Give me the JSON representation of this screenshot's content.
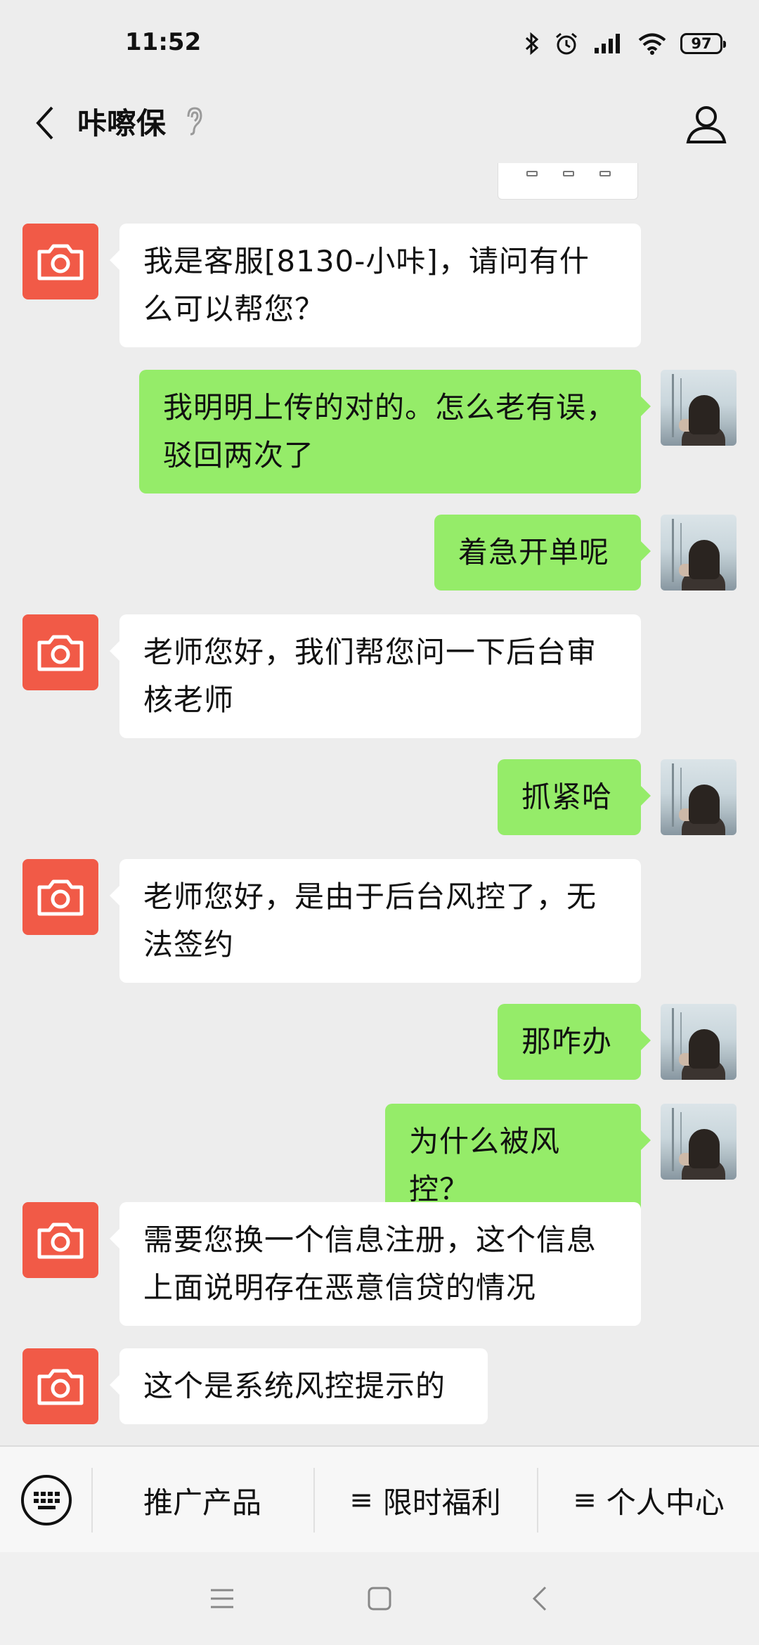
{
  "status_bar": {
    "time": "11:52",
    "battery": "97",
    "icons": [
      "bluetooth-icon",
      "alarm-icon",
      "signal-icon",
      "wifi-icon",
      "battery-icon"
    ]
  },
  "header": {
    "title": "咔嚓保",
    "icons": [
      "back-arrow-icon",
      "ear-icon",
      "profile-icon"
    ]
  },
  "messages": [
    {
      "side": "left",
      "text": "我是客服[8130-小咔]，请问有什\n么可以帮您？"
    },
    {
      "side": "right",
      "text": "我明明上传的对的。怎么老有误，\n驳回两次了"
    },
    {
      "side": "right",
      "text": "着急开单呢"
    },
    {
      "side": "left",
      "text": "老师您好，我们帮您问一下后台审\n核老师"
    },
    {
      "side": "right",
      "text": "抓紧哈"
    },
    {
      "side": "left",
      "text": "老师您好，是由于后台风控了，无\n法签约"
    },
    {
      "side": "right",
      "text": "那咋办"
    },
    {
      "side": "right",
      "text": "为什么被风控？"
    },
    {
      "side": "left",
      "text": "需要您换一个信息注册，这个信息\n上面说明存在恶意信贷的情况"
    },
    {
      "side": "left",
      "text": "这个是系统风控提示的"
    }
  ],
  "menu": {
    "items": [
      "推广产品",
      "限时福利",
      "个人中心"
    ],
    "menu_prefix": "≡"
  },
  "colors": {
    "background": "#ededed",
    "bubble_self": "#95ec69",
    "bubble_other": "#ffffff",
    "avatar_camera": "#f15a47"
  }
}
